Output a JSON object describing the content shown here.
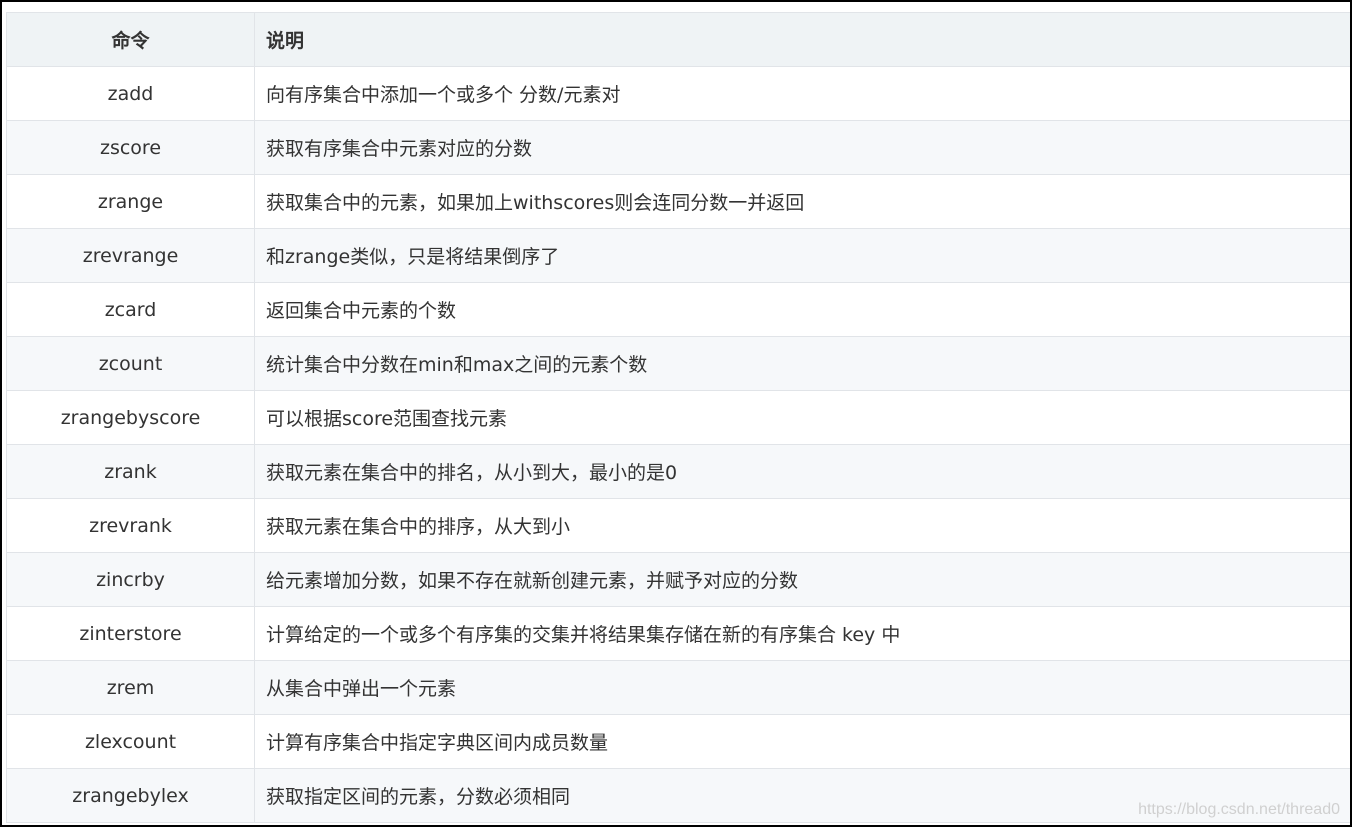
{
  "table": {
    "headers": {
      "command": "命令",
      "description": "说明"
    },
    "rows": [
      {
        "command": "zadd",
        "description": "向有序集合中添加一个或多个 分数/元素对"
      },
      {
        "command": "zscore",
        "description": "获取有序集合中元素对应的分数"
      },
      {
        "command": "zrange",
        "description": "获取集合中的元素，如果加上withscores则会连同分数一并返回"
      },
      {
        "command": "zrevrange",
        "description": "和zrange类似，只是将结果倒序了"
      },
      {
        "command": "zcard",
        "description": "返回集合中元素的个数"
      },
      {
        "command": "zcount",
        "description": "统计集合中分数在min和max之间的元素个数"
      },
      {
        "command": "zrangebyscore",
        "description": "可以根据score范围查找元素"
      },
      {
        "command": "zrank",
        "description": "获取元素在集合中的排名，从小到大，最小的是0"
      },
      {
        "command": "zrevrank",
        "description": "获取元素在集合中的排序，从大到小"
      },
      {
        "command": "zincrby",
        "description": "给元素增加分数，如果不存在就新创建元素，并赋予对应的分数"
      },
      {
        "command": "zinterstore",
        "description": "计算给定的一个或多个有序集的交集并将结果集存储在新的有序集合 key 中"
      },
      {
        "command": "zrem",
        "description": "从集合中弹出一个元素"
      },
      {
        "command": "zlexcount",
        "description": "计算有序集合中指定字典区间内成员数量"
      },
      {
        "command": "zrangebylex",
        "description": "获取指定区间的元素，分数必须相同"
      }
    ]
  },
  "watermark": "https://blog.csdn.net/thread0"
}
